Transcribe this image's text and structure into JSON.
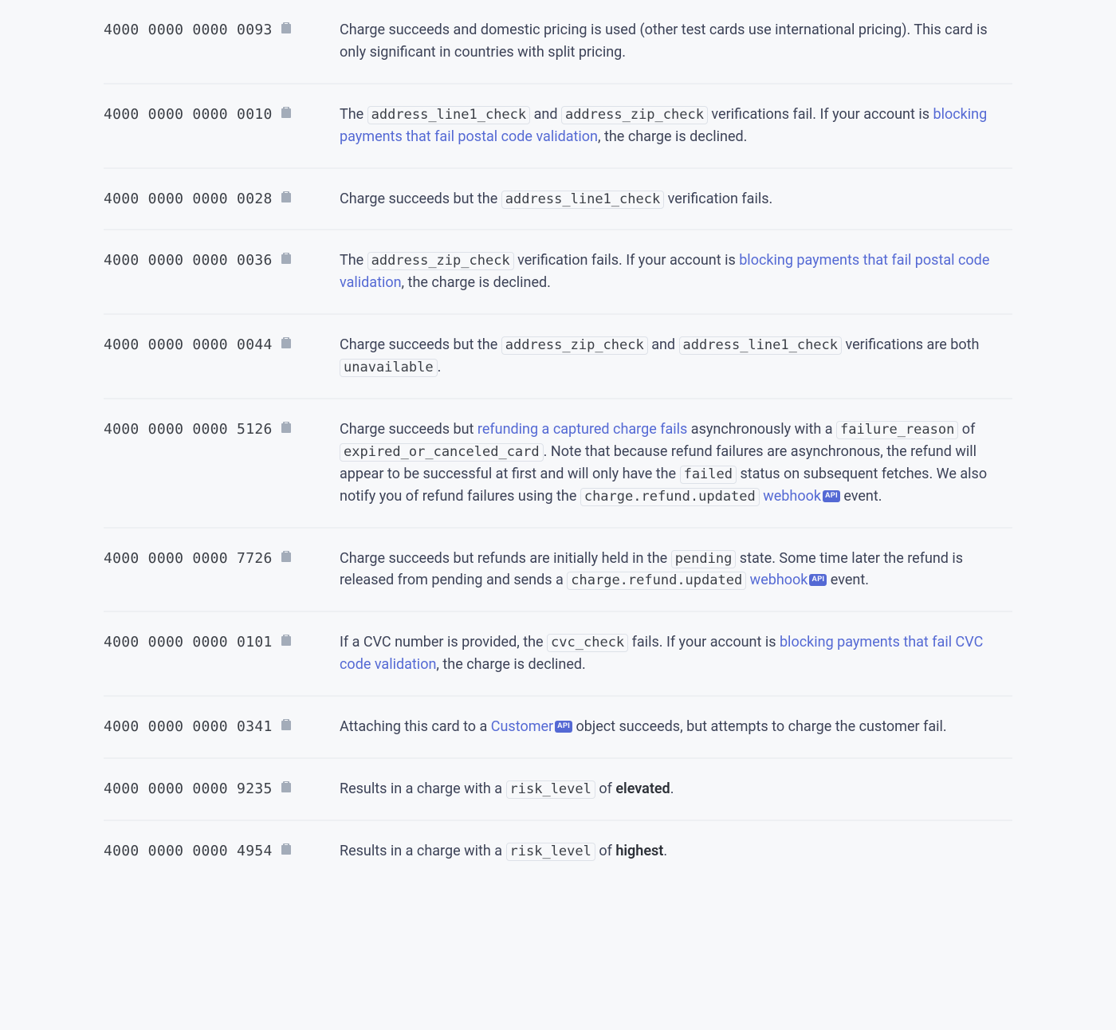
{
  "api_badge_text": "API",
  "rows": [
    {
      "card": "4000 0000 0000 0093",
      "segments": [
        {
          "type": "text",
          "val": "Charge succeeds and domestic pricing is used (other test cards use international pricing). This card is only significant in countries with split pricing."
        }
      ]
    },
    {
      "card": "4000 0000 0000 0010",
      "segments": [
        {
          "type": "text",
          "val": "The "
        },
        {
          "type": "code",
          "val": "address_line1_check"
        },
        {
          "type": "text",
          "val": " and "
        },
        {
          "type": "code",
          "val": "address_zip_check"
        },
        {
          "type": "text",
          "val": " verifications fail. If your account is "
        },
        {
          "type": "link",
          "val": "blocking payments that fail postal code validation"
        },
        {
          "type": "text",
          "val": ", the charge is declined."
        }
      ]
    },
    {
      "card": "4000 0000 0000 0028",
      "segments": [
        {
          "type": "text",
          "val": "Charge succeeds but the "
        },
        {
          "type": "code",
          "val": "address_line1_check"
        },
        {
          "type": "text",
          "val": " verification fails."
        }
      ]
    },
    {
      "card": "4000 0000 0000 0036",
      "segments": [
        {
          "type": "text",
          "val": "The "
        },
        {
          "type": "code",
          "val": "address_zip_check"
        },
        {
          "type": "text",
          "val": " verification fails. If your account is "
        },
        {
          "type": "link",
          "val": "blocking payments that fail postal code validation"
        },
        {
          "type": "text",
          "val": ", the charge is declined."
        }
      ]
    },
    {
      "card": "4000 0000 0000 0044",
      "segments": [
        {
          "type": "text",
          "val": "Charge succeeds but the "
        },
        {
          "type": "code",
          "val": "address_zip_check"
        },
        {
          "type": "text",
          "val": " and "
        },
        {
          "type": "code",
          "val": "address_line1_check"
        },
        {
          "type": "text",
          "val": " verifications are both "
        },
        {
          "type": "code",
          "val": "unavailable"
        },
        {
          "type": "text",
          "val": "."
        }
      ]
    },
    {
      "card": "4000 0000 0000 5126",
      "segments": [
        {
          "type": "text",
          "val": "Charge succeeds but "
        },
        {
          "type": "link",
          "val": "refunding a captured charge fails"
        },
        {
          "type": "text",
          "val": " asynchronously with a "
        },
        {
          "type": "code",
          "val": "failure_reason"
        },
        {
          "type": "text",
          "val": " of "
        },
        {
          "type": "code",
          "val": "expired_or_canceled_card"
        },
        {
          "type": "text",
          "val": ". Note that because refund failures are asynchronous, the refund will appear to be successful at first and will only have the "
        },
        {
          "type": "code",
          "val": "failed"
        },
        {
          "type": "text",
          "val": " status on subsequent fetches. We also notify you of refund failures using the "
        },
        {
          "type": "code",
          "val": "charge.refund.updated"
        },
        {
          "type": "text",
          "val": " "
        },
        {
          "type": "apilink",
          "val": "webhook"
        },
        {
          "type": "text",
          "val": " event."
        }
      ]
    },
    {
      "card": "4000 0000 0000 7726",
      "segments": [
        {
          "type": "text",
          "val": "Charge succeeds but refunds are initially held in the "
        },
        {
          "type": "code",
          "val": "pending"
        },
        {
          "type": "text",
          "val": " state. Some time later the refund is released from pending and sends a "
        },
        {
          "type": "code",
          "val": "charge.refund.updated"
        },
        {
          "type": "text",
          "val": " "
        },
        {
          "type": "apilink",
          "val": "webhook"
        },
        {
          "type": "text",
          "val": " event."
        }
      ]
    },
    {
      "card": "4000 0000 0000 0101",
      "segments": [
        {
          "type": "text",
          "val": "If a CVC number is provided, the "
        },
        {
          "type": "code",
          "val": "cvc_check"
        },
        {
          "type": "text",
          "val": " fails. If your account is "
        },
        {
          "type": "link",
          "val": "blocking payments that fail CVC code validation"
        },
        {
          "type": "text",
          "val": ", the charge is declined."
        }
      ]
    },
    {
      "card": "4000 0000 0000 0341",
      "segments": [
        {
          "type": "text",
          "val": "Attaching this card to a "
        },
        {
          "type": "apilink",
          "val": "Customer"
        },
        {
          "type": "text",
          "val": " object succeeds, but attempts to charge the customer fail."
        }
      ]
    },
    {
      "card": "4000 0000 0000 9235",
      "segments": [
        {
          "type": "text",
          "val": "Results in a charge with a "
        },
        {
          "type": "code",
          "val": "risk_level"
        },
        {
          "type": "text",
          "val": " of "
        },
        {
          "type": "strong",
          "val": "elevated"
        },
        {
          "type": "text",
          "val": "."
        }
      ]
    },
    {
      "card": "4000 0000 0000 4954",
      "segments": [
        {
          "type": "text",
          "val": "Results in a charge with a "
        },
        {
          "type": "code",
          "val": "risk_level"
        },
        {
          "type": "text",
          "val": " of "
        },
        {
          "type": "strong",
          "val": "highest"
        },
        {
          "type": "text",
          "val": "."
        }
      ]
    }
  ]
}
